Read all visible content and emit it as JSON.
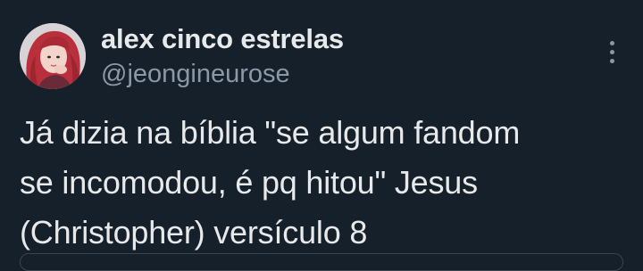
{
  "tweet": {
    "author": {
      "display_name": "alex cinco estrelas",
      "handle": "@jeongineurose"
    },
    "text_lines": [
      "Já dizia na bíblia \"se algum fandom",
      "se incomodou, é pq hitou\" Jesus",
      "(Christopher) versículo 8"
    ]
  },
  "icons": {
    "more": "more-vertical-icon"
  },
  "colors": {
    "background": "#16202b",
    "primary_text": "#e7e9ea",
    "secondary_text": "#8b98a5"
  }
}
